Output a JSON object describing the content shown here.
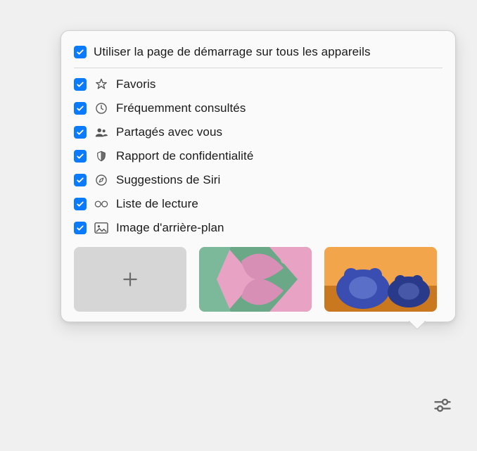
{
  "header": {
    "use_on_all_devices_label": "Utiliser la page de démarrage sur tous les appareils"
  },
  "options": [
    {
      "id": "favoris",
      "label": "Favoris",
      "icon": "star",
      "checked": true
    },
    {
      "id": "frequemment",
      "label": "Fréquemment consultés",
      "icon": "clock",
      "checked": true
    },
    {
      "id": "partages",
      "label": "Partagés avec vous",
      "icon": "people",
      "checked": true
    },
    {
      "id": "rapport",
      "label": "Rapport de confidentialité",
      "icon": "shield",
      "checked": true
    },
    {
      "id": "siri",
      "label": "Suggestions de Siri",
      "icon": "globe",
      "checked": true
    },
    {
      "id": "lecture",
      "label": "Liste de lecture",
      "icon": "glasses",
      "checked": true
    },
    {
      "id": "background",
      "label": "Image d'arrière-plan",
      "icon": "image",
      "checked": true
    }
  ],
  "thumbnails": [
    {
      "id": "add",
      "type": "add"
    },
    {
      "id": "butterfly",
      "type": "art"
    },
    {
      "id": "bears",
      "type": "art"
    },
    {
      "id": "partial",
      "type": "art"
    }
  ]
}
